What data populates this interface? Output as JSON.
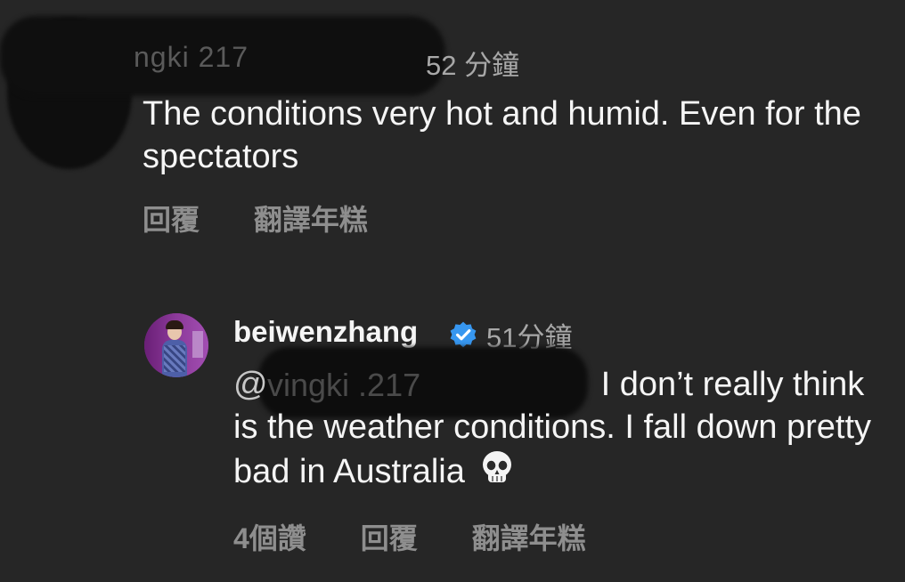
{
  "comments": [
    {
      "username_visible_fragment": "ngki 217",
      "timestamp": "52 分鐘",
      "text": "The conditions very hot and humid. Even for the spectators",
      "actions": {
        "reply": "回覆",
        "translate": "翻譯年糕"
      }
    },
    {
      "username": "beiwenzhang",
      "verified": true,
      "timestamp": "51分鐘",
      "mention_prefix": "@",
      "mention_visible_fragment": "vingki .217",
      "text": "I don’t really think is the weather conditions. I fall down pretty bad in Australia",
      "emoji": "skull-emoji",
      "actions": {
        "likes": "4個讚",
        "reply": "回覆",
        "translate": "翻譯年糕"
      }
    }
  ],
  "colors": {
    "background": "#262626",
    "primary_text": "#f5f5f5",
    "secondary_text": "#a8a8a8",
    "action_text": "#8e8e8e",
    "verified_badge": "#3797f0"
  }
}
